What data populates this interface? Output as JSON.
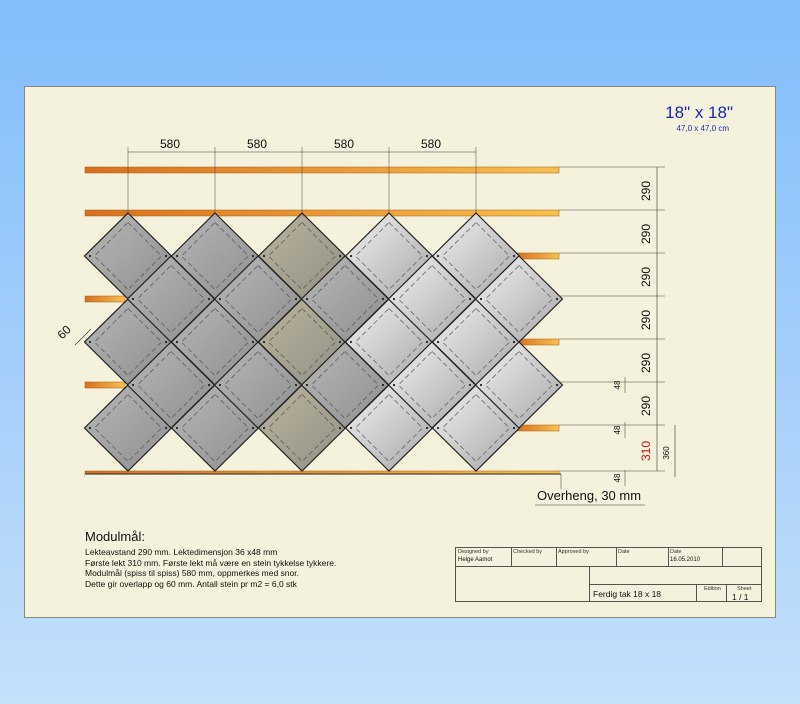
{
  "size": {
    "title": "18\" x 18\"",
    "subtitle": "47,0 x 47,0 cm"
  },
  "dims": {
    "top": [
      "580",
      "580",
      "580",
      "580"
    ],
    "right": [
      "290",
      "290",
      "290",
      "290",
      "290",
      "290"
    ],
    "first_batten": "310",
    "overlap_small": [
      "48",
      "48",
      "48"
    ],
    "total": "360",
    "overlap": "60",
    "overhang": "Overheng, 30 mm"
  },
  "notes": {
    "title": "Modulmål:",
    "lines": [
      "Lekteavstand 290 mm. Lektedimensjon 36 x48 mm",
      "Første lekt 310 mm. Første lekt må være en stein tykkelse tykkere.",
      "Modulmål (spiss til spiss) 580 mm, oppmerkes med snor.",
      "Dette gir overlapp og 60 mm. Antall stein pr m2 = 6,0 stk"
    ]
  },
  "title_block": {
    "designed_by_label": "Designed by",
    "designed_by": "Helge Aamot",
    "checked_by_label": "Checked by",
    "approved_by_label": "Approved by",
    "date_label": "Date",
    "date_label2": "Date",
    "date": "16.05.2010",
    "drawing_title": "Ferdig tak 18 x 18",
    "edition_label": "Edition",
    "sheet_label": "Sheet",
    "sheet": "1 / 1"
  },
  "colors": {
    "accent": "#1a2ab0",
    "red_dim": "#cc1111",
    "batten": "#f0a040",
    "tile": "#a8a8a8"
  }
}
